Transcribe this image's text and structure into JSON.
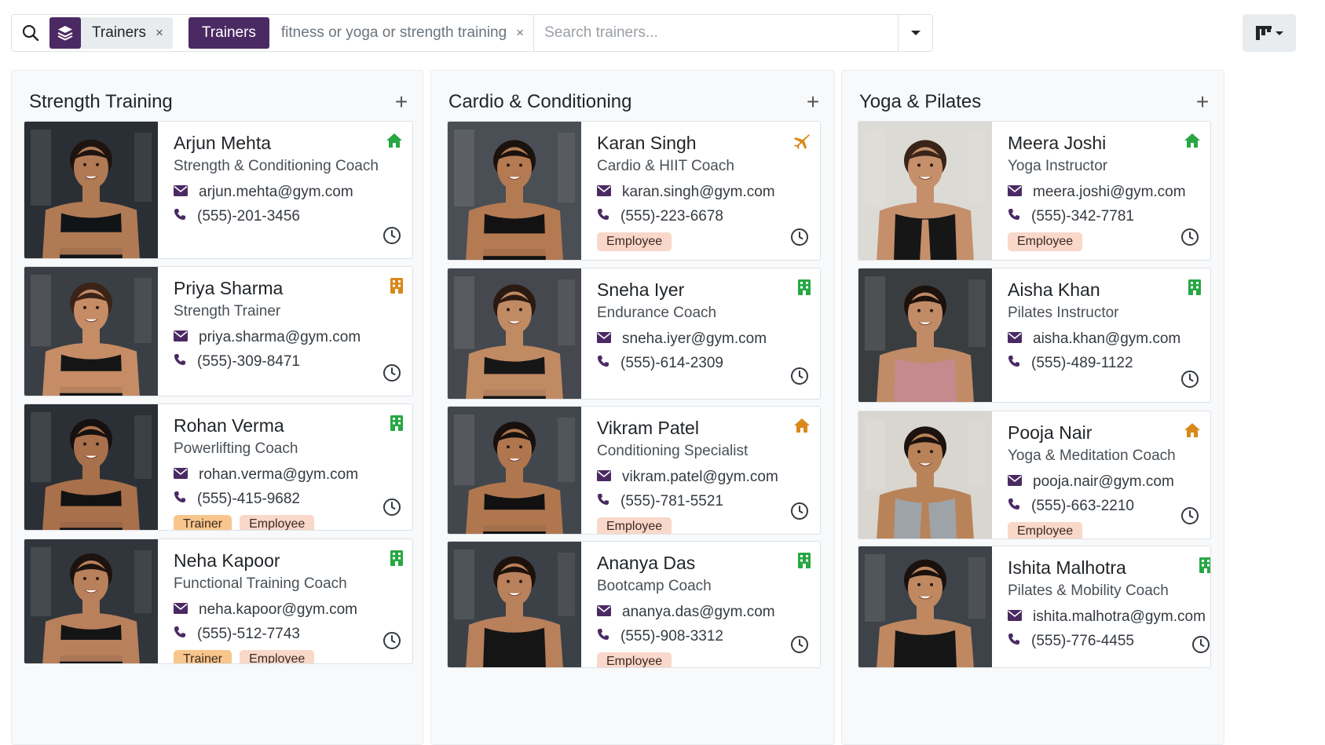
{
  "search": {
    "facet1_label": "Trainers",
    "facet1_remove": "×",
    "facet2_label": "Trainers",
    "facet2_value": "fitness or yoga or strength training",
    "facet2_remove": "×",
    "placeholder": "Search trainers..."
  },
  "colors": {
    "accent": "#4b2a63",
    "employee_tag": "#f9d7c9",
    "trainer_tag": "#f8c68c",
    "status_green": "#28a745",
    "status_orange": "#d9891a"
  },
  "columns": [
    {
      "title": "Strength Training",
      "add": "+",
      "cards": [
        {
          "name": "Arjun Mehta",
          "job": "Strength & Conditioning Coach",
          "email": "arjun.mehta@gym.com",
          "phone": "(555)-201-3456",
          "status_icon": "home-icon",
          "status_color": "#28a745",
          "tags": [],
          "photo": {
            "bg": "#2a2f35",
            "skin": "#b07a55",
            "hair": "#1d1410",
            "shirt": "#111417",
            "arms": "crossed"
          }
        },
        {
          "name": "Priya Sharma",
          "job": "Strength Trainer",
          "email": "priya.sharma@gym.com",
          "phone": "(555)-309-8471",
          "status_icon": "building-icon",
          "status_color": "#d9891a",
          "tags": [],
          "photo": {
            "bg": "#3a3f45",
            "skin": "#c58c66",
            "hair": "#3b2417",
            "shirt": "#151515",
            "arms": "crossed"
          }
        },
        {
          "name": "Rohan Verma",
          "job": "Powerlifting Coach",
          "email": "rohan.verma@gym.com",
          "phone": "(555)-415-9682",
          "status_icon": "building-icon",
          "status_color": "#28a745",
          "tags": [
            "Trainer",
            "Employee"
          ],
          "photo": {
            "bg": "#2a3035",
            "skin": "#a9704c",
            "hair": "#161010",
            "shirt": "#121212",
            "arms": "crossed"
          }
        },
        {
          "name": "Neha Kapoor",
          "job": "Functional Training Coach",
          "email": "neha.kapoor@gym.com",
          "phone": "(555)-512-7743",
          "status_icon": "building-icon",
          "status_color": "#28a745",
          "tags": [
            "Trainer",
            "Employee"
          ],
          "photo": {
            "bg": "#30363c",
            "skin": "#b9805c",
            "hair": "#1d130e",
            "shirt": "#141414",
            "arms": "crossed"
          }
        }
      ]
    },
    {
      "title": "Cardio & Conditioning",
      "add": "+",
      "cards": [
        {
          "name": "Karan Singh",
          "job": "Cardio & HIIT Coach",
          "email": "karan.singh@gym.com",
          "phone": "(555)-223-6678",
          "status_icon": "plane-icon",
          "status_color": "#d9891a",
          "tags": [
            "Employee"
          ],
          "photo": {
            "bg": "#4a4f55",
            "skin": "#b47a52",
            "hair": "#1a120d",
            "shirt": "#121212",
            "arms": "crossed"
          }
        },
        {
          "name": "Sneha Iyer",
          "job": "Endurance Coach",
          "email": "sneha.iyer@gym.com",
          "phone": "(555)-614-2309",
          "status_icon": "building-icon",
          "status_color": "#28a745",
          "tags": [],
          "photo": {
            "bg": "#45494f",
            "skin": "#c08a63",
            "hair": "#2b1a12",
            "shirt": "#161616",
            "arms": "crossed"
          }
        },
        {
          "name": "Vikram Patel",
          "job": "Conditioning Specialist",
          "email": "vikram.patel@gym.com",
          "phone": "(555)-781-5521",
          "status_icon": "home-icon",
          "status_color": "#d9891a",
          "tags": [
            "Employee"
          ],
          "photo": {
            "bg": "#42474d",
            "skin": "#b0774f",
            "hair": "#17100c",
            "shirt": "#111111",
            "arms": "crossed"
          }
        },
        {
          "name": "Ananya Das",
          "job": "Bootcamp Coach",
          "email": "ananya.das@gym.com",
          "phone": "(555)-908-3312",
          "status_icon": "building-icon",
          "status_color": "#28a745",
          "tags": [
            "Employee"
          ],
          "photo": {
            "bg": "#3c4147",
            "skin": "#b8805b",
            "hair": "#1c120c",
            "shirt": "#151515",
            "arms": "down"
          }
        }
      ]
    },
    {
      "title": "Yoga & Pilates",
      "add": "+",
      "cards": [
        {
          "name": "Meera Joshi",
          "job": "Yoga Instructor",
          "email": "meera.joshi@gym.com",
          "phone": "(555)-342-7781",
          "status_icon": "home-icon",
          "status_color": "#28a745",
          "tags": [
            "Employee"
          ],
          "photo": {
            "bg": "#dcdad4",
            "skin": "#c48f6a",
            "hair": "#3a2418",
            "shirt": "#161616",
            "arms": "pray"
          }
        },
        {
          "name": "Aisha Khan",
          "job": "Pilates Instructor",
          "email": "aisha.khan@gym.com",
          "phone": "(555)-489-1122",
          "status_icon": "building-icon",
          "status_color": "#28a745",
          "tags": [],
          "photo": {
            "bg": "#3a3d40",
            "skin": "#c08b66",
            "hair": "#1c120c",
            "shirt": "#c48a8e",
            "arms": "down"
          }
        },
        {
          "name": "Pooja Nair",
          "job": "Yoga & Meditation Coach",
          "email": "pooja.nair@gym.com",
          "phone": "(555)-663-2210",
          "status_icon": "home-icon",
          "status_color": "#d9891a",
          "tags": [
            "Employee"
          ],
          "photo": {
            "bg": "#d9d6cf",
            "skin": "#b98359",
            "hair": "#1d130e",
            "shirt": "#9ea3a8",
            "arms": "pray"
          }
        },
        {
          "name": "Ishita Malhotra",
          "job": "Pilates & Mobility Coach",
          "email": "ishita.malhotra@gym.com",
          "phone": "(555)-776-4455",
          "status_icon": "building-icon",
          "status_color": "#28a745",
          "tags": [],
          "photo": {
            "bg": "#3e4349",
            "skin": "#bf8861",
            "hair": "#1a110c",
            "shirt": "#161616",
            "arms": "down"
          }
        }
      ]
    }
  ]
}
